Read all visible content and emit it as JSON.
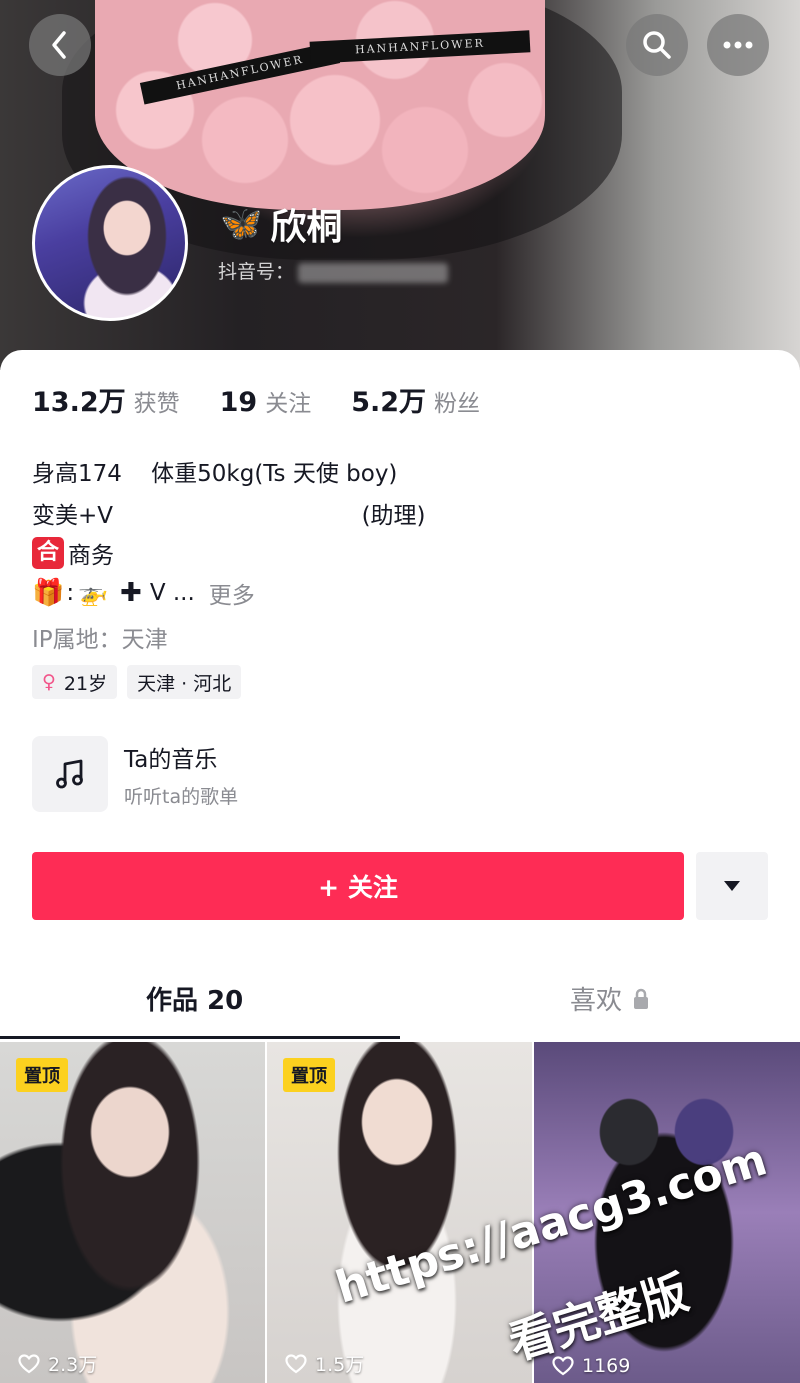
{
  "header": {
    "ribbon_text": "HANHANFLOWER",
    "back_icon": "chevron-left-icon",
    "search_icon": "search-icon",
    "more_icon": "more-dots-icon"
  },
  "profile": {
    "name_emoji": "🦋",
    "name": "欣桐",
    "douyin_id_label": "抖音号："
  },
  "stats": [
    {
      "num": "13.2万",
      "label": "获赞"
    },
    {
      "num": "19",
      "label": "关注"
    },
    {
      "num": "5.2万",
      "label": "粉丝"
    }
  ],
  "bio": {
    "line1": "身高174    体重50kg(Ts 天使 boy)",
    "line2": "变美+V                                  (助理)",
    "line3_badge": "合",
    "line3_text": "商务",
    "line4_gift": "🎁",
    "line4_colon": ":",
    "line4_heli": "🚁",
    "line4_plus": "✚",
    "line4_v": "V ...",
    "more": "更多",
    "ip": "IP属地：天津"
  },
  "tags": {
    "gender_symbol": "♀",
    "age": "21岁",
    "location": "天津 · 河北"
  },
  "music": {
    "icon": "music-note-icon",
    "title": "Ta的音乐",
    "subtitle": "听听ta的歌单"
  },
  "actions": {
    "follow": "+ 关注",
    "dropdown_icon": "caret-down-icon"
  },
  "tabs": {
    "works": "作品 20",
    "likes": "喜欢",
    "likes_lock_icon": "lock-icon"
  },
  "videos": [
    {
      "pinned": "置顶",
      "likes": "2.3万"
    },
    {
      "pinned": "置顶",
      "likes": "1.5万"
    },
    {
      "pinned": "",
      "likes": "1169"
    }
  ],
  "watermark": {
    "line1": "https://aacg3.com",
    "line2": "看完整版"
  },
  "colors": {
    "accent": "#fe2c55",
    "pin": "#fcd11f",
    "muted": "#8a8b91",
    "text": "#161823"
  }
}
